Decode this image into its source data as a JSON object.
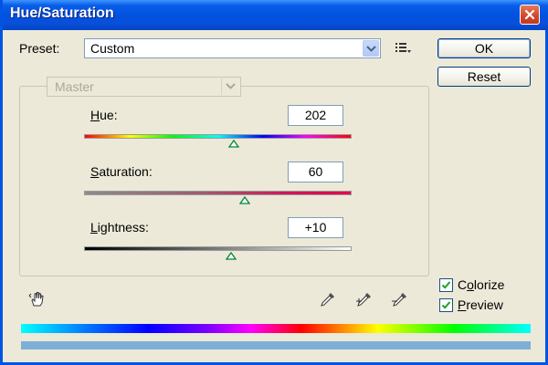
{
  "window": {
    "title": "Hue/Saturation"
  },
  "preset": {
    "label": "Preset:",
    "value": "Custom"
  },
  "buttons": {
    "ok": "OK",
    "reset": "Reset"
  },
  "edit": {
    "value": "Master"
  },
  "hue": {
    "label": "Hue:",
    "value": "202"
  },
  "saturation": {
    "label": "Saturation:",
    "value": "60"
  },
  "lightness": {
    "label": "Lightness:",
    "value": "+10"
  },
  "options": {
    "colorize": {
      "label": "Colorize",
      "checked": true
    },
    "preview": {
      "label": "Preview",
      "checked": true
    }
  },
  "icons": {
    "close": "close-icon",
    "dropdown": "chevron-down-icon",
    "preset_menu": "list-menu-icon",
    "hand": "hand-adjust-icon",
    "eyedroppers": [
      "eyedropper-icon",
      "eyedropper-add-icon",
      "eyedropper-subtract-icon"
    ]
  },
  "colors": {
    "titlebar": "#0052e0",
    "dialog_bg": "#ece9d8",
    "close_button": "#d0452b"
  }
}
